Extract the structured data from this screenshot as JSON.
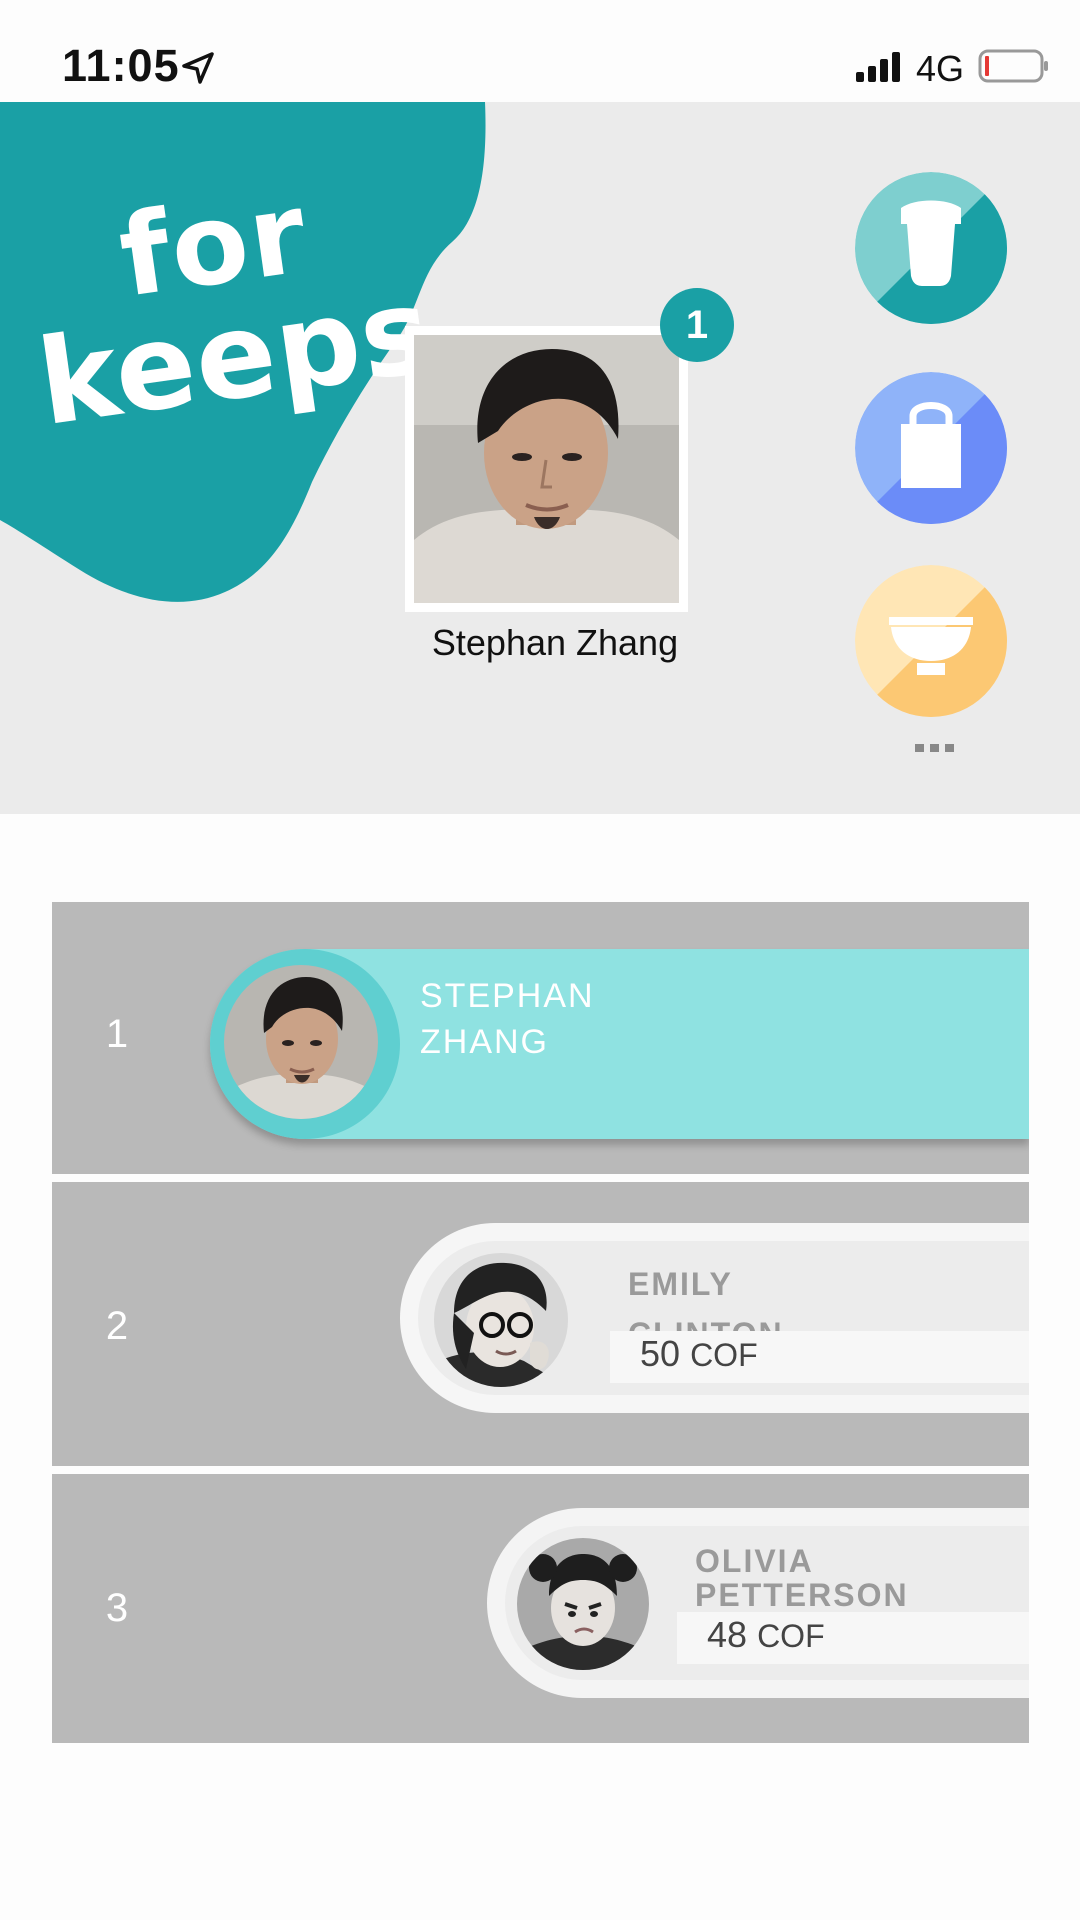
{
  "status_bar": {
    "time": "11:05",
    "network": "4G"
  },
  "header": {
    "logo": "for keeps",
    "profile": {
      "name": "Stephan Zhang",
      "rank_badge": "1"
    },
    "categories": [
      {
        "icon": "cup-icon",
        "colors": [
          "#7ecfcf",
          "#1aa0a5"
        ]
      },
      {
        "icon": "bag-icon",
        "colors": [
          "#8fb3f9",
          "#6b8cf8"
        ]
      },
      {
        "icon": "bowl-icon",
        "colors": [
          "#ffe6b5",
          "#fcc873"
        ]
      }
    ],
    "more_label": "..."
  },
  "leaderboard": [
    {
      "rank": "1",
      "name_line1": "STEPHAN",
      "name_line2": "ZHANG",
      "score": ""
    },
    {
      "rank": "2",
      "name_line1": "EMILY",
      "name_line2": "CLINTON",
      "score": "50",
      "unit": "COF"
    },
    {
      "rank": "3",
      "name_line1": "OLIVIA",
      "name_line2": "PETTERSON",
      "score": "48",
      "unit": "COF"
    }
  ]
}
